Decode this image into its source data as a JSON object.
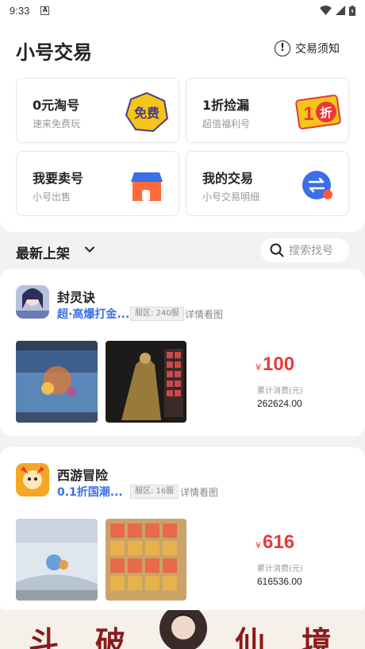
{
  "status_bar": {
    "time": "9:33",
    "notification_badge": "A"
  },
  "header": {
    "title": "小号交易",
    "notice_label": "交易须知"
  },
  "cards": [
    {
      "title": "0元淘号",
      "subtitle": "速来免费玩",
      "graphic_text": "免费",
      "icon": "free-badge-icon"
    },
    {
      "title": "1折捡漏",
      "subtitle": "超值福利号",
      "graphic_text_1": "1",
      "graphic_text_2": "折",
      "icon": "discount-badge-icon"
    },
    {
      "title": "我要卖号",
      "subtitle": "小号出售",
      "icon": "shop-icon"
    },
    {
      "title": "我的交易",
      "subtitle": "小号交易明细",
      "icon": "exchange-icon"
    }
  ],
  "filter": {
    "sort_label": "最新上架",
    "search_placeholder": "搜索找号"
  },
  "listings": [
    {
      "game_name": "封灵诀",
      "tag": "超·高爆打金...",
      "server": "服区: 240服",
      "detail_label": "详情看图",
      "currency": "¥",
      "price": "100",
      "spent_label": "累计消费(元)",
      "spent_value": "262624.00"
    },
    {
      "game_name": "西游冒险",
      "tag": "0.1折国潮...",
      "server": "服区: 16服",
      "detail_label": "详情看图",
      "currency": "¥",
      "price": "616",
      "spent_label": "累计消费(元)",
      "spent_value": "616536.00"
    }
  ],
  "banner": {
    "chars": [
      "斗",
      "破",
      "仙",
      "境"
    ]
  },
  "colors": {
    "accent_blue": "#3a6fe8",
    "price_red": "#e83a3a",
    "page_bg": "#f2f2f2"
  }
}
